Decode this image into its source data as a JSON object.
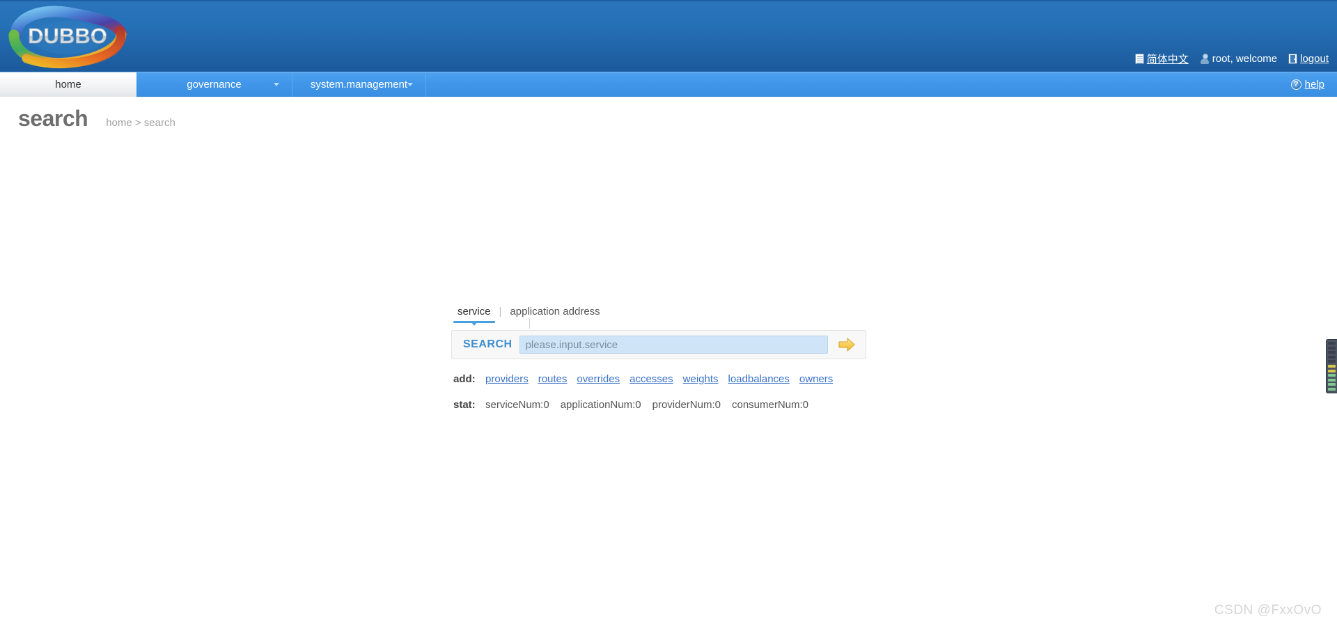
{
  "header": {
    "logo_text": "DUBBO",
    "logo_alt": "dubbo-logo",
    "lang_link": "简体中文",
    "lang_icon": "page-icon",
    "user_text": "root, welcome",
    "user_icon": "user-icon",
    "logout_link": "logout",
    "logout_icon": "door-icon",
    "bg_color": "#2670b7"
  },
  "nav": {
    "items": [
      {
        "label": "home",
        "active": true,
        "caret": false
      },
      {
        "label": "governance",
        "active": false,
        "caret": true
      },
      {
        "label": "system.management",
        "active": false,
        "caret": true
      }
    ],
    "help_label": "help",
    "help_icon": "question-circle-icon",
    "bg_color": "#3f95e8"
  },
  "page": {
    "title": "search",
    "breadcrumb": "home > search"
  },
  "search": {
    "tabs": [
      {
        "label": "service",
        "active": true
      },
      {
        "label": "application address",
        "active": false
      }
    ],
    "separator": "|",
    "button_label": "SEARCH",
    "placeholder": "please.input.service",
    "value": "",
    "go_icon": "arrow-right-icon",
    "accent_color": "#3f8ed0",
    "input_bg": "#cfe5f7"
  },
  "add_row": {
    "key": "add:",
    "links": [
      "providers",
      "routes",
      "overrides",
      "accesses",
      "weights",
      "loadbalances",
      "owners"
    ]
  },
  "stat_row": {
    "key": "stat:",
    "items": [
      "serviceNum:0",
      "applicationNum:0",
      "providerNum:0",
      "consumerNum:0"
    ]
  },
  "edge_widget": {
    "name": "level-meter-widget",
    "levels": [
      "#3b414c",
      "#3b414c",
      "#3b414c",
      "#3b414c",
      "#3b414c",
      "#d8c84a",
      "#d8c84a",
      "#7ec98f",
      "#7ec98f",
      "#7ec98f",
      "#7ec98f"
    ]
  },
  "watermark": "CSDN @FxxOvO"
}
